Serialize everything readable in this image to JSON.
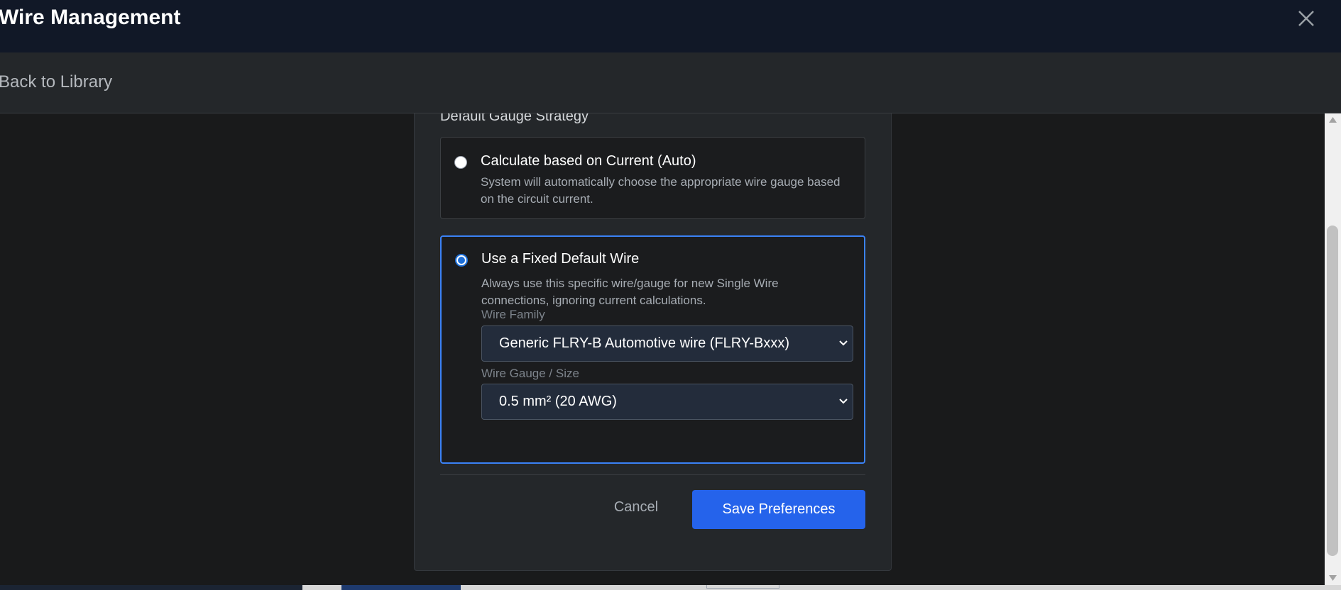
{
  "window": {
    "title": "Wire Management"
  },
  "nav": {
    "back_label": "Back to Library"
  },
  "preferences": {
    "section_heading": "Default Gauge Strategy",
    "options": [
      {
        "title": "Calculate based on Current (Auto)",
        "description": "System will automatically choose the appropriate wire gauge based on the circuit current.",
        "selected": false
      },
      {
        "title": "Use a Fixed Default Wire",
        "description": "Always use this specific wire/gauge for new Single Wire connections, ignoring current calculations.",
        "selected": true
      }
    ],
    "wire_family": {
      "label": "Wire Family",
      "value": "Generic FLRY-B Automotive wire (FLRY-Bxxx)"
    },
    "wire_gauge": {
      "label": "Wire Gauge / Size",
      "value": "0.5 mm² (20 AWG)"
    },
    "cancel_label": "Cancel",
    "save_label": "Save Preferences"
  },
  "icons": {
    "close": "close-icon",
    "chevron": "chevron-down-icon",
    "scroll_up": "scroll-up-arrow-icon",
    "scroll_down": "scroll-down-arrow-icon"
  },
  "colors": {
    "accent": "#2563eb",
    "selected_border": "#3b82f6",
    "titlebar": "#111827"
  }
}
